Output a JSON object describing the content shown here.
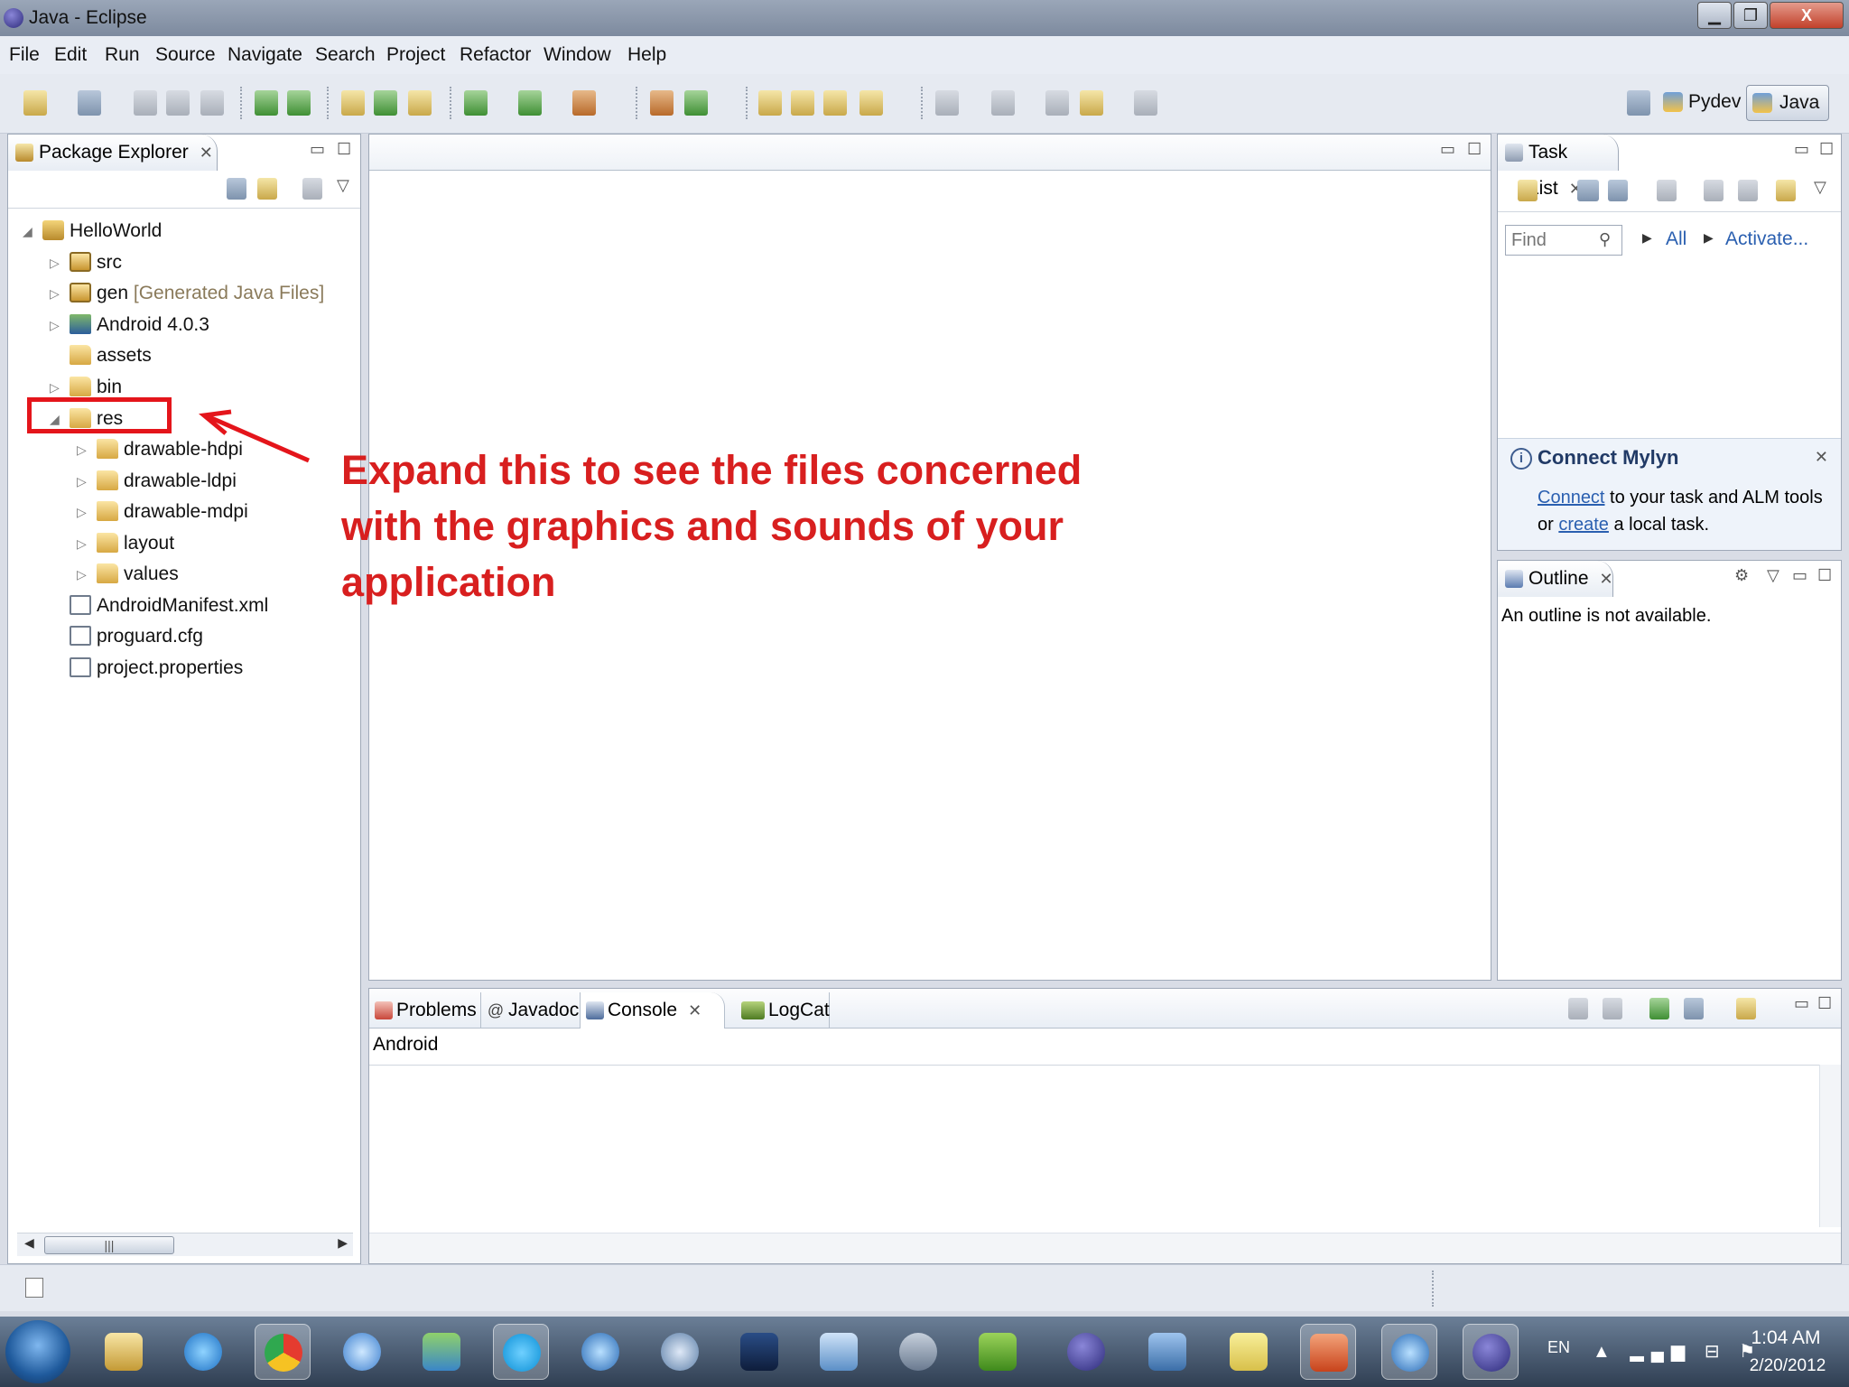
{
  "window": {
    "title": "Java - Eclipse",
    "close_label": "X"
  },
  "menubar": {
    "items": [
      "File",
      "Edit",
      "Run",
      "Source",
      "Navigate",
      "Search",
      "Project",
      "Refactor",
      "Window",
      "Help"
    ]
  },
  "toolbar": {
    "perspectives": [
      "Pydev",
      "Java"
    ]
  },
  "package_explorer": {
    "title": "Package Explorer",
    "tree": [
      {
        "label": "HelloWorld",
        "icon": "project-icon"
      },
      {
        "label": "src",
        "icon": "source-folder-icon"
      },
      {
        "label": "gen",
        "decoration": "[Generated Java Files]",
        "icon": "source-folder-icon"
      },
      {
        "label": "Android 4.0.3",
        "icon": "library-icon"
      },
      {
        "label": "assets",
        "icon": "folder-icon"
      },
      {
        "label": "bin",
        "icon": "folder-icon"
      },
      {
        "label": "res",
        "icon": "folder-icon"
      },
      {
        "label": "drawable-hdpi",
        "icon": "folder-icon"
      },
      {
        "label": "drawable-ldpi",
        "icon": "folder-icon"
      },
      {
        "label": "drawable-mdpi",
        "icon": "folder-icon"
      },
      {
        "label": "layout",
        "icon": "folder-icon"
      },
      {
        "label": "values",
        "icon": "folder-icon"
      },
      {
        "label": "AndroidManifest.xml",
        "icon": "xml-file-icon"
      },
      {
        "label": "proguard.cfg",
        "icon": "text-file-icon"
      },
      {
        "label": "project.properties",
        "icon": "text-file-icon"
      }
    ]
  },
  "task_list": {
    "title": "Task List",
    "find_placeholder": "Find",
    "links": [
      "All",
      "Activate..."
    ],
    "mylyn": {
      "title": "Connect Mylyn",
      "connect_link": "Connect",
      "line1_rest": " to your task and ALM tools",
      "or": "or ",
      "create_link": "create",
      "line2_rest": " a local task."
    }
  },
  "outline": {
    "title": "Outline",
    "message": "An outline is not available."
  },
  "console": {
    "tabs": [
      "Problems",
      "Javadoc",
      "Console",
      "LogCat"
    ],
    "active_tab": "Console",
    "name": "Android"
  },
  "annotation": {
    "text": "Expand this to see the files concerned with the graphics and sounds of your application",
    "color": "#d81f1f"
  },
  "taskbar": {
    "language": "EN",
    "time": "1:04 AM",
    "date": "2/20/2012",
    "apps": [
      "windows-explorer-icon",
      "internet-explorer-icon",
      "chrome-icon",
      "safari-icon",
      "messenger-icon",
      "skype-icon",
      "itunes-icon",
      "quicktime-icon",
      "photoshop-icon",
      "image-viewer-icon",
      "infinity-icon",
      "qt-icon",
      "eclipse-icon",
      "castle-icon",
      "sticky-notes-icon",
      "powerpoint-icon",
      "itunes-icon",
      "eclipse-icon"
    ]
  }
}
